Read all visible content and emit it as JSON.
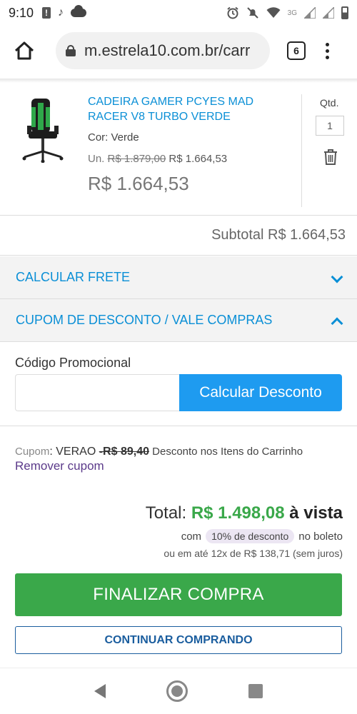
{
  "status_bar": {
    "time": "9:10",
    "network": "3G"
  },
  "browser": {
    "url": "m.estrela10.com.br/carr",
    "tab_count": "6"
  },
  "product": {
    "name": "CADEIRA GAMER PCYES MAD RACER V8 TURBO VERDE",
    "color": "Cor: Verde",
    "unit_prefix": "Un.",
    "unit_old_price": "R$ 1.879,00",
    "unit_new_price": "R$ 1.664,53",
    "line_total": "R$ 1.664,53",
    "qty_label": "Qtd.",
    "qty_value": "1"
  },
  "subtotal": "Subtotal R$ 1.664,53",
  "accordions": {
    "freight": "CALCULAR FRETE",
    "coupon": "CUPOM DE DESCONTO / VALE COMPRAS"
  },
  "promo": {
    "label": "Código Promocional",
    "input_value": "",
    "button": "Calcular Desconto"
  },
  "coupon": {
    "label": "Cupom",
    "code": ": VERAO ",
    "discount": "-R$ 89,40",
    "description": " Desconto nos Itens do Carrinho",
    "remove": "Remover cupom"
  },
  "totals": {
    "total_label": "Total: ",
    "total_amount": "R$ 1.498,08",
    "total_suffix": " à vista",
    "disc_prefix": "com",
    "disc_badge": "10% de desconto",
    "disc_suffix": "no boleto",
    "installments": "ou em até 12x de R$ 138,71 (sem juros)"
  },
  "buttons": {
    "finalize": "FINALIZAR COMPRA",
    "continue": "CONTINUAR COMPRANDO"
  },
  "colors": {
    "link_blue": "#0a8fd6",
    "primary_button": "#1e9bf0",
    "finalize_green": "#3aa84a",
    "coupon_purple": "#5b3a8a"
  }
}
